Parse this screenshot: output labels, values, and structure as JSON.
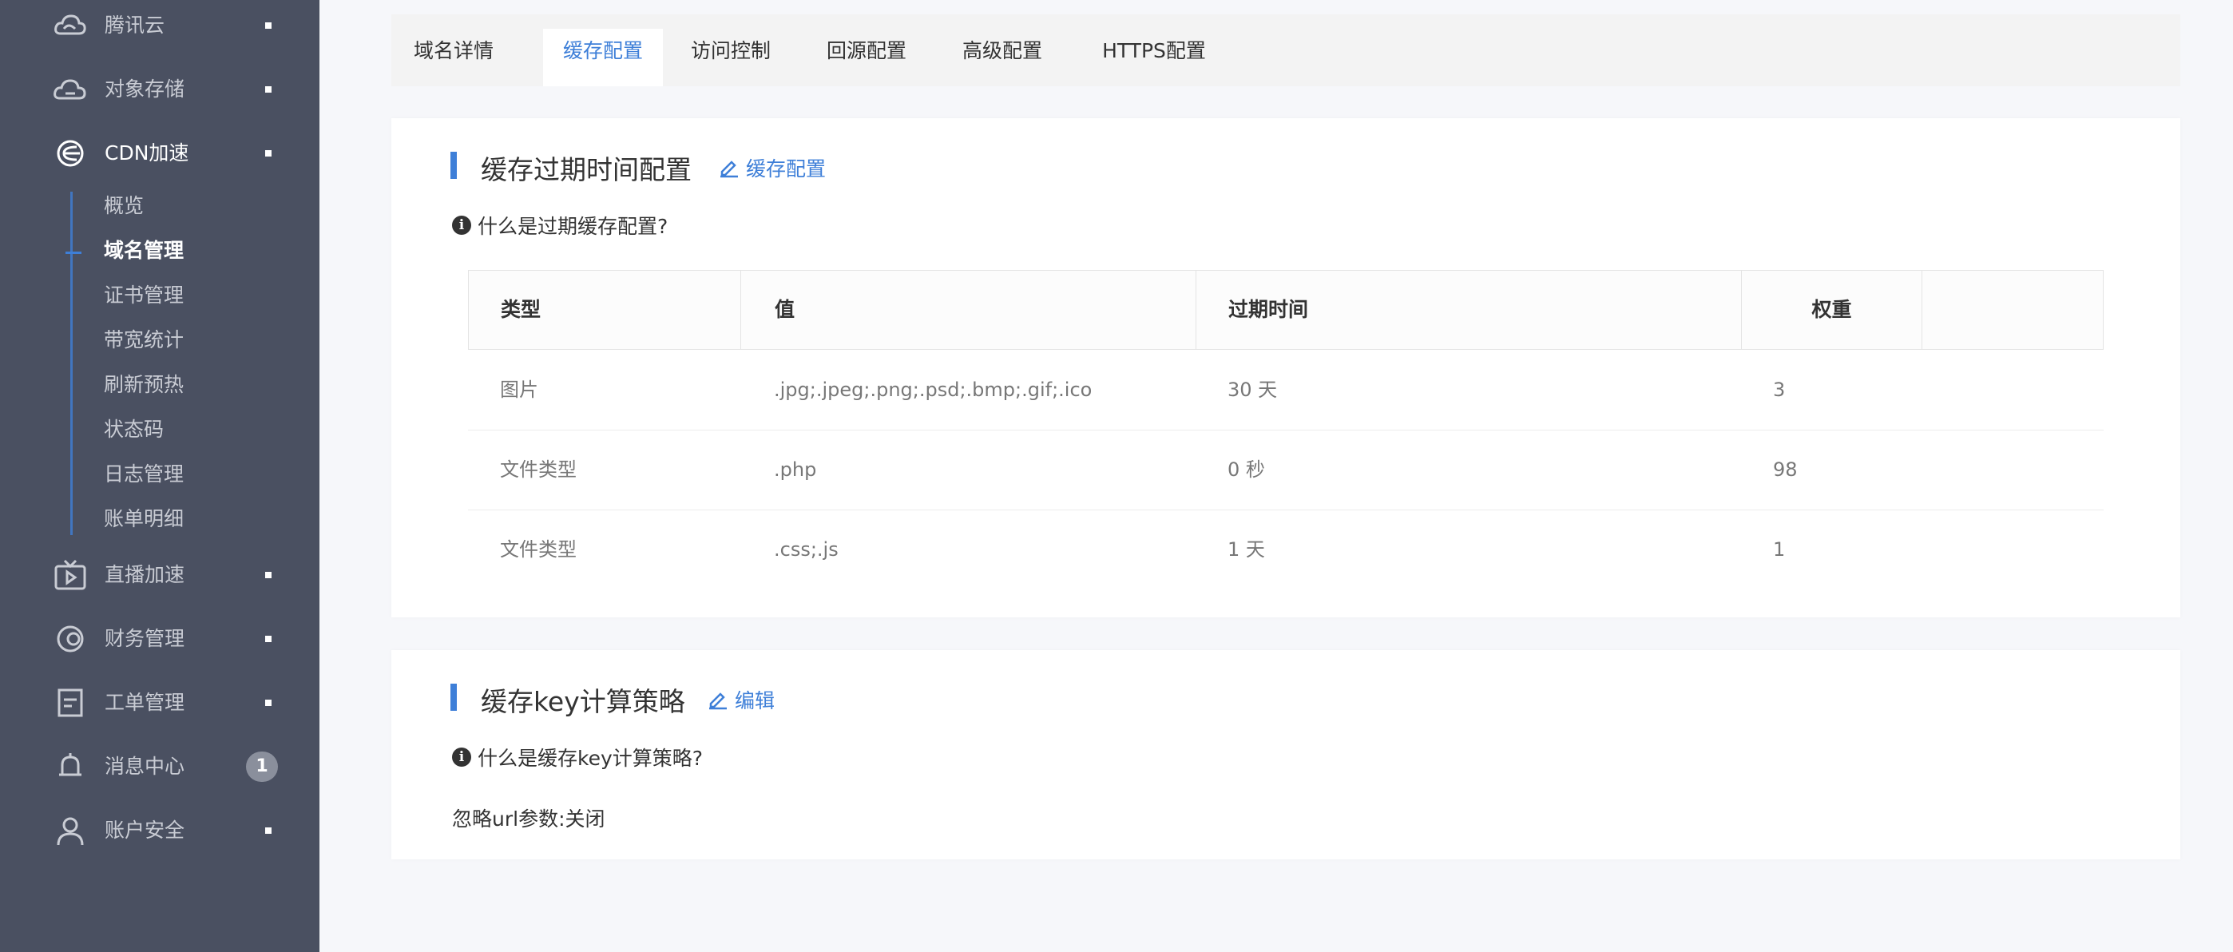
{
  "sidebar": {
    "items": [
      {
        "label": "腾讯云",
        "icon": "cloud-icon"
      },
      {
        "label": "对象存储",
        "icon": "cloud-storage-icon"
      },
      {
        "label": "CDN加速",
        "icon": "cdn-icon"
      },
      {
        "label": "直播加速",
        "icon": "tv-icon"
      },
      {
        "label": "财务管理",
        "icon": "finance-icon"
      },
      {
        "label": "工单管理",
        "icon": "ticket-icon"
      },
      {
        "label": "消息中心",
        "icon": "bell-icon",
        "badge": "1"
      },
      {
        "label": "账户安全",
        "icon": "user-icon"
      }
    ],
    "cdn_sub": [
      "概览",
      "域名管理",
      "证书管理",
      "带宽统计",
      "刷新预热",
      "状态码",
      "日志管理",
      "账单明细"
    ]
  },
  "tabs": [
    "域名详情",
    "缓存配置",
    "访问控制",
    "回源配置",
    "高级配置",
    "HTTPS配置"
  ],
  "active_tab": "缓存配置",
  "cache_expire": {
    "title": "缓存过期时间配置",
    "edit_label": "缓存配置",
    "help": "什么是过期缓存配置?",
    "columns": [
      "类型",
      "值",
      "过期时间",
      "权重",
      ""
    ],
    "rows": [
      {
        "type": "图片",
        "value": ".jpg;.jpeg;.png;.psd;.bmp;.gif;.ico",
        "expire": "30 天",
        "weight": "3"
      },
      {
        "type": "文件类型",
        "value": ".php",
        "expire": "0 秒",
        "weight": "98"
      },
      {
        "type": "文件类型",
        "value": ".css;.js",
        "expire": "1 天",
        "weight": "1"
      }
    ]
  },
  "cache_key": {
    "title": "缓存key计算策略",
    "edit_label": "编辑",
    "help": "什么是缓存key计算策略?",
    "ignore_url_label": "忽略url参数:关闭"
  },
  "colors": {
    "accent": "#3e7fd8",
    "sidebar_bg": "#4a5061"
  }
}
